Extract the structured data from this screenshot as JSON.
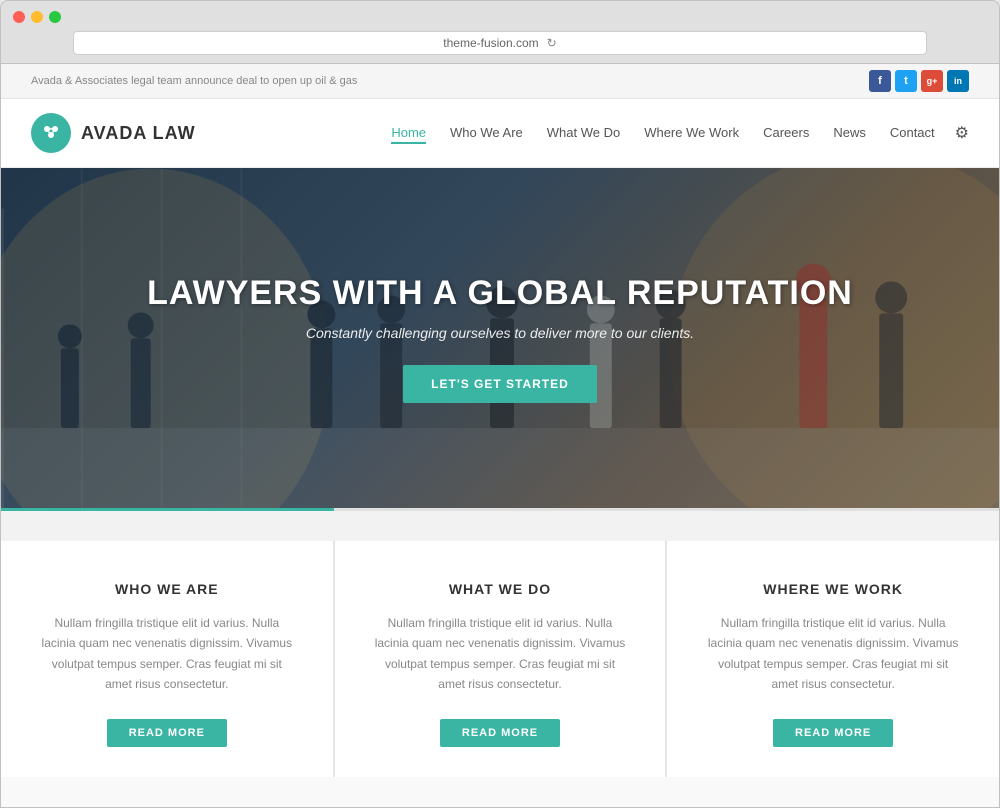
{
  "browser": {
    "url": "theme-fusion.com",
    "dots": [
      "red",
      "yellow",
      "green"
    ]
  },
  "topbar": {
    "announcement": "Avada & Associates legal team announce deal to open up oil & gas",
    "social": [
      {
        "name": "facebook",
        "label": "f"
      },
      {
        "name": "twitter",
        "label": "t"
      },
      {
        "name": "google-plus",
        "label": "g+"
      },
      {
        "name": "linkedin",
        "label": "in"
      }
    ]
  },
  "nav": {
    "logo_text": "AVADA LAW",
    "links": [
      {
        "label": "Home",
        "active": true
      },
      {
        "label": "Who We Are",
        "active": false
      },
      {
        "label": "What We Do",
        "active": false
      },
      {
        "label": "Where We Work",
        "active": false
      },
      {
        "label": "Careers",
        "active": false
      },
      {
        "label": "News",
        "active": false
      },
      {
        "label": "Contact",
        "active": false
      }
    ]
  },
  "hero": {
    "title": "LAWYERS WITH A GLOBAL REPUTATION",
    "subtitle": "Constantly challenging ourselves to deliver more to our clients.",
    "cta_button": "LET'S GET STARTED"
  },
  "cards": [
    {
      "title": "WHO WE ARE",
      "text": "Nullam fringilla tristique elit id varius. Nulla lacinia quam nec venenatis dignissim. Vivamus volutpat tempus semper. Cras feugiat mi sit amet risus consectetur.",
      "button": "READ MORE"
    },
    {
      "title": "WHAT WE DO",
      "text": "Nullam fringilla tristique elit id varius. Nulla lacinia quam nec venenatis dignissim. Vivamus volutpat tempus semper. Cras feugiat mi sit amet risus consectetur.",
      "button": "READ MORE"
    },
    {
      "title": "WHERE WE WORK",
      "text": "Nullam fringilla tristique elit id varius. Nulla lacinia quam nec venenatis dignissim. Vivamus volutpat tempus semper. Cras feugiat mi sit amet risus consectetur.",
      "button": "READ MORE"
    }
  ],
  "colors": {
    "teal": "#3ab5a4",
    "dark": "#333333",
    "gray": "#888888"
  }
}
